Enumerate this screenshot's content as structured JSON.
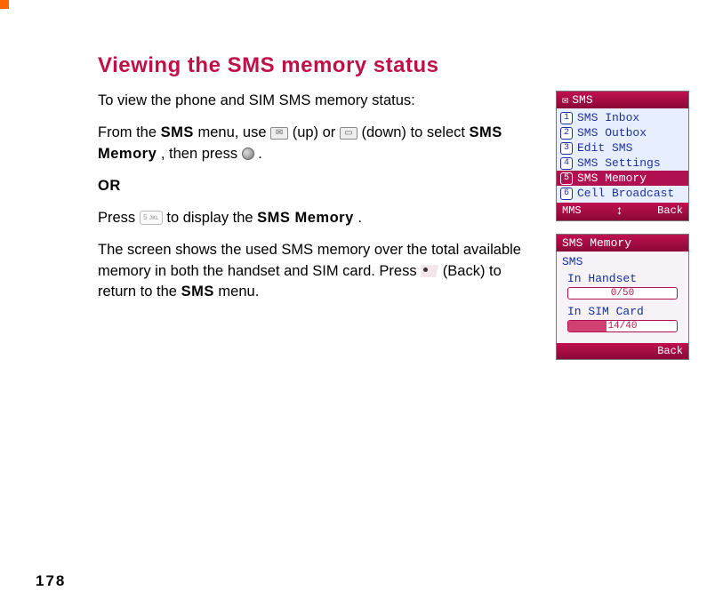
{
  "heading": "Viewing the SMS memory status",
  "intro": "To view the phone and SIM SMS memory status:",
  "para1": {
    "p1": "From the ",
    "sms": "SMS",
    "p2": " menu, use ",
    "p3": " (up) or ",
    "p4": " (down) to select ",
    "smsmem": "SMS Memory",
    "p5": ", then press ",
    "p6": "."
  },
  "or_label": "OR",
  "para2": {
    "p1": "Press ",
    "p2": " to display the ",
    "smsmem": "SMS Memory",
    "p3": "."
  },
  "para3": {
    "p1": "The screen shows the used SMS memory over the total available memory in both the handset and SIM card. Press ",
    "p2": " (Back) to return to the ",
    "sms": "SMS",
    "p3": " menu."
  },
  "page_number": "178",
  "phone1": {
    "title": "SMS",
    "items": [
      {
        "n": "1",
        "label": "SMS Inbox"
      },
      {
        "n": "2",
        "label": "SMS Outbox"
      },
      {
        "n": "3",
        "label": "Edit SMS"
      },
      {
        "n": "4",
        "label": "SMS Settings"
      },
      {
        "n": "5",
        "label": "SMS Memory"
      },
      {
        "n": "6",
        "label": "Cell Broadcast"
      }
    ],
    "soft_left": "MMS",
    "soft_mid": "↕",
    "soft_right": "Back",
    "selected_index": 4
  },
  "phone2": {
    "title": "SMS Memory",
    "subhead": "SMS",
    "handset_label": "In Handset",
    "handset_value": "0/50",
    "handset_fill_pct": 0,
    "sim_label": "In SIM Card",
    "sim_value": "14/40",
    "sim_fill_pct": 35,
    "soft_right": "Back"
  }
}
